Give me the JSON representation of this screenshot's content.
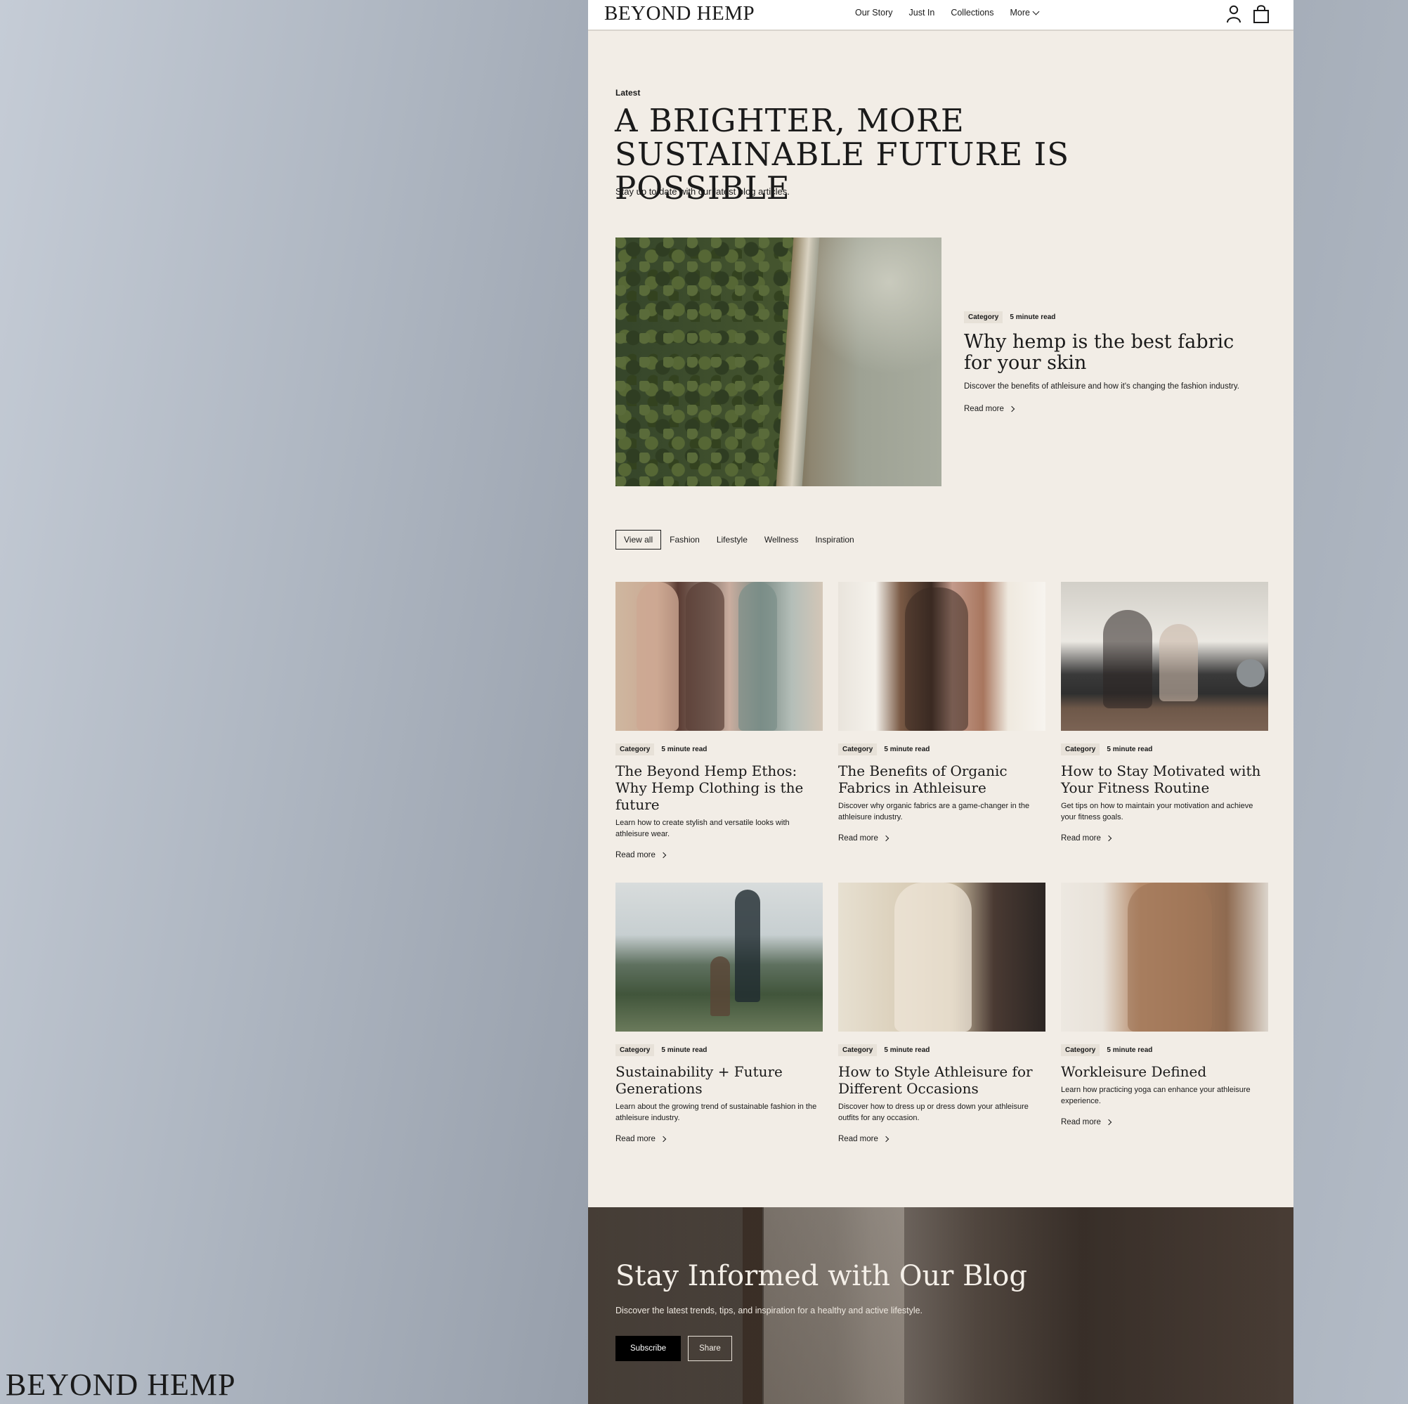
{
  "corner_logo": "BEYOND HEMP",
  "header": {
    "brand": "BEYOND HEMP",
    "nav": [
      "Our Story",
      "Just In",
      "Collections"
    ],
    "more_label": "More",
    "icons": [
      "account-icon",
      "cart-icon"
    ]
  },
  "hero": {
    "eyebrow": "Latest",
    "headline": "A BRIGHTER, MORE SUSTAINABLE FUTURE IS POSSIBLE",
    "subline": "Stay up to date with our latest blog articles."
  },
  "featured": {
    "category": "Category",
    "read_time": "5 minute read",
    "title": "Why hemp is the best fabric for your skin",
    "description": "Discover the benefits of athleisure and how it's changing the fashion industry.",
    "read_more": "Read more"
  },
  "filters": {
    "active": "View all",
    "items": [
      "View all",
      "Fashion",
      "Lifestyle",
      "Wellness",
      "Inspiration"
    ]
  },
  "posts": [
    {
      "category": "Category",
      "read_time": "5 minute read",
      "title": "The Beyond Hemp Ethos: Why Hemp Clothing is the future",
      "description": "Learn how to create stylish and versatile looks with athleisure wear.",
      "read_more": "Read more"
    },
    {
      "category": "Category",
      "read_time": "5 minute read",
      "title": "The Benefits of Organic Fabrics in Athleisure",
      "description": "Discover why organic fabrics are a game-changer in the athleisure industry.",
      "read_more": "Read more"
    },
    {
      "category": "Category",
      "read_time": "5 minute read",
      "title": "How to Stay Motivated with Your Fitness Routine",
      "description": "Get tips on how to maintain your motivation and achieve your fitness goals.",
      "read_more": "Read more"
    },
    {
      "category": "Category",
      "read_time": "5 minute read",
      "title": "Sustainability + Future Generations",
      "description": "Learn about the growing trend of sustainable fashion in the athleisure industry.",
      "read_more": "Read more"
    },
    {
      "category": "Category",
      "read_time": "5 minute read",
      "title": "How to Style Athleisure for Different Occasions",
      "description": "Discover how to dress up or dress down your athleisure outfits for any occasion.",
      "read_more": "Read more"
    },
    {
      "category": "Category",
      "read_time": "5 minute read",
      "title": "Workleisure Defined",
      "description": "Learn how practicing yoga can enhance your athleisure experience.",
      "read_more": "Read more"
    }
  ],
  "newsletter": {
    "title": "Stay Informed with Our Blog",
    "subtitle": "Discover the latest trends, tips, and inspiration for a healthy and active lifestyle.",
    "subscribe_label": "Subscribe",
    "share_label": "Share"
  },
  "colors": {
    "page_bg": "#f2ede6",
    "accent_dark": "#000000",
    "text": "#1a1a1a"
  }
}
